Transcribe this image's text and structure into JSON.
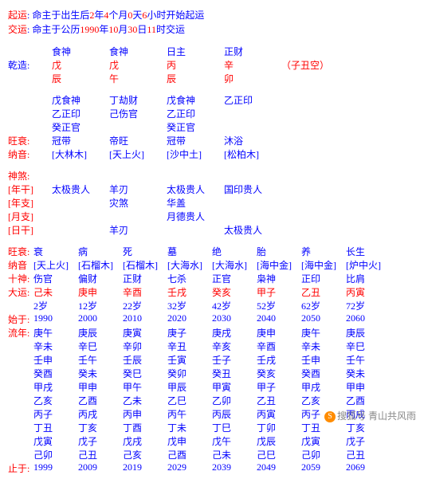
{
  "header": {
    "qiyun_label": "起运",
    "qiyun_a": ": 命主于出生后",
    "qy_y": "2",
    "qy_yl": "年",
    "qy_m": "4",
    "qy_ml": "个月",
    "qy_d": "0",
    "qy_dl": "天",
    "qy_h": "6",
    "qy_hl": "小时开始起运",
    "jiaoyun_label": "交运",
    "jiaoyun_a": ": 命主于公历",
    "jy_y": "1990",
    "jy_yl": "年",
    "jy_m": "10",
    "jy_ml": "月",
    "jy_d": "30",
    "jy_dl": "日",
    "jy_h": "11",
    "jy_hl": "时交运"
  },
  "pillars": {
    "shen": [
      "食神",
      "食神",
      "日主",
      "正财"
    ],
    "qz": "乾造:",
    "gan": [
      "戊",
      "戊",
      "丙",
      "辛"
    ],
    "kong": "（子丑空）",
    "zhi": [
      "辰",
      "午",
      "辰",
      "卯"
    ],
    "cang": [
      [
        "戊食神",
        "乙正印",
        "癸正官"
      ],
      [
        "丁劫财",
        "己伤官",
        ""
      ],
      [
        "戊食神",
        "乙正印",
        "癸正官"
      ],
      [
        "乙正印",
        "",
        ""
      ]
    ],
    "ws_lbl": "旺衰:",
    "ws": [
      "冠带",
      "帝旺",
      "冠带",
      "沐浴"
    ],
    "ny_lbl": "纳音:",
    "ny": [
      "[大林木]",
      "[天上火]",
      "[沙中土]",
      "[松柏木]"
    ]
  },
  "shensha": {
    "title": "神煞:",
    "rows": [
      {
        "lbl": "[年干]",
        "v": [
          "太极贵人",
          "羊刃",
          "太极贵人",
          "国印贵人"
        ]
      },
      {
        "lbl": "[年支]",
        "v": [
          "",
          "灾煞",
          "华盖",
          ""
        ]
      },
      {
        "lbl": "[月支]",
        "v": [
          "",
          "",
          "月德贵人",
          ""
        ]
      },
      {
        "lbl": "[日干]",
        "v": [
          "",
          "羊刃",
          "",
          "太极贵人"
        ]
      }
    ]
  },
  "wang": {
    "lbl": "旺衰:",
    "v": [
      "衰",
      "病",
      "死",
      "墓",
      "绝",
      "胎",
      "养",
      "长生"
    ]
  },
  "nayin": {
    "lbl": "纳音",
    "v": [
      "[天上火]",
      "[石榴木]",
      "[石榴木]",
      "[大海水]",
      "[大海水]",
      "[海中金]",
      "[海中金]",
      "[炉中火]"
    ]
  },
  "shishen": {
    "lbl": "十神:",
    "v": [
      "伤官",
      "偏财",
      "正财",
      "七杀",
      "正官",
      "枭神",
      "正印",
      "比肩"
    ]
  },
  "dayun": {
    "lbl": "大运:",
    "gz": [
      "己未",
      "庚申",
      "辛酉",
      "壬戌",
      "癸亥",
      "甲子",
      "乙丑",
      "丙寅"
    ],
    "age": [
      "2岁",
      "12岁",
      "22岁",
      "32岁",
      "42岁",
      "52岁",
      "62岁",
      "72岁"
    ]
  },
  "shiyu": {
    "lbl": "始于:",
    "v": [
      "1990",
      "2000",
      "2010",
      "2020",
      "2030",
      "2040",
      "2050",
      "2060"
    ]
  },
  "liunian": {
    "lbl": "流年:",
    "rows": [
      [
        "庚午",
        "庚辰",
        "庚寅",
        "庚子",
        "庚戌",
        "庚申",
        "庚午",
        "庚辰"
      ],
      [
        "辛未",
        "辛巳",
        "辛卯",
        "辛丑",
        "辛亥",
        "辛酉",
        "辛未",
        "辛巳"
      ],
      [
        "壬申",
        "壬午",
        "壬辰",
        "壬寅",
        "壬子",
        "壬戌",
        "壬申",
        "壬午"
      ],
      [
        "癸酉",
        "癸未",
        "癸巳",
        "癸卯",
        "癸丑",
        "癸亥",
        "癸酉",
        "癸未"
      ],
      [
        "甲戌",
        "甲申",
        "甲午",
        "甲辰",
        "甲寅",
        "甲子",
        "甲戌",
        "甲申"
      ],
      [
        "乙亥",
        "乙酉",
        "乙未",
        "乙巳",
        "乙卯",
        "乙丑",
        "乙亥",
        "乙酉"
      ],
      [
        "丙子",
        "丙戌",
        "丙申",
        "丙午",
        "丙辰",
        "丙寅",
        "丙子",
        "丙戌"
      ],
      [
        "丁丑",
        "丁亥",
        "丁酉",
        "丁未",
        "丁巳",
        "丁卯",
        "丁丑",
        "丁亥"
      ],
      [
        "戊寅",
        "戊子",
        "戊戌",
        "戊申",
        "戊午",
        "戊辰",
        "戊寅",
        "戊子"
      ],
      [
        "己卯",
        "己丑",
        "己亥",
        "己酉",
        "己未",
        "己巳",
        "己卯",
        "己丑"
      ]
    ]
  },
  "zhiyu": {
    "lbl": "止于:",
    "v": [
      "1999",
      "2009",
      "2019",
      "2029",
      "2039",
      "2049",
      "2059",
      "2069"
    ]
  },
  "wm": {
    "brand": "搜狐号",
    "author": "青山共风雨"
  }
}
